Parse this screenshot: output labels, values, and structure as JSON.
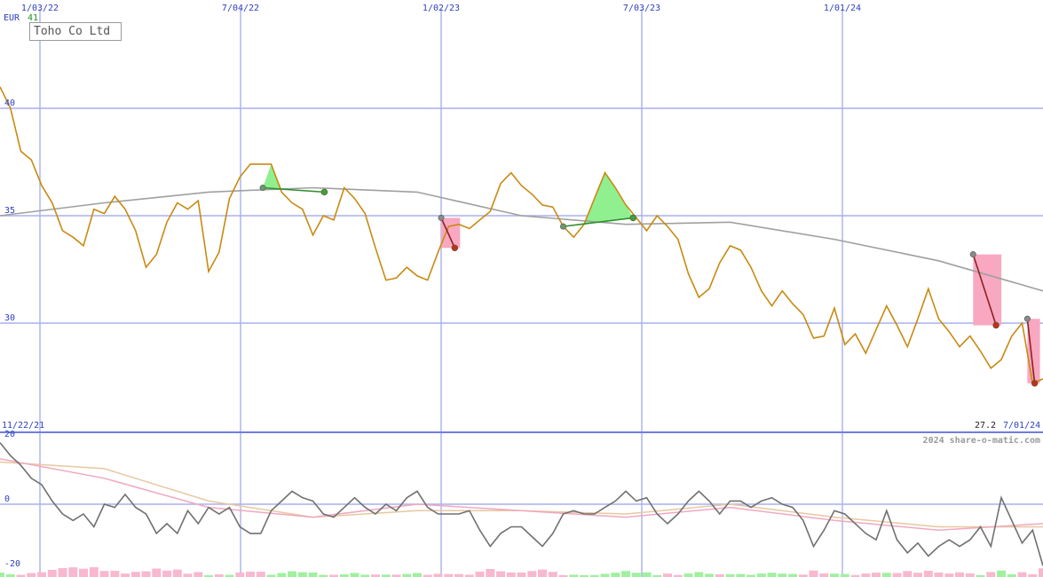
{
  "chart_data": [
    {
      "type": "line",
      "title": "Toho Co Ltd",
      "currency": "EUR",
      "currency_value": "41",
      "x_tick_labels": [
        "1/03/22",
        "7/04/22",
        "1/02/23",
        "7/03/23",
        "1/01/24"
      ],
      "start_date_label": "11/22/21",
      "end_date_label": "7/01/24",
      "last_value_label": "27.2",
      "credit": "2024 share-o-matic.com",
      "y_ticks": [
        40,
        35,
        30
      ],
      "ylim": [
        25,
        44
      ],
      "grid": true,
      "colors": {
        "price": "#c88a12",
        "moving_average": "#a0a0a0",
        "up_fill": "#90f090",
        "down_fill": "#f8a8c0"
      },
      "series": [
        {
          "role": "price",
          "x": [
            0,
            0.01,
            0.02,
            0.03,
            0.04,
            0.05,
            0.06,
            0.07,
            0.08,
            0.09,
            0.1,
            0.11,
            0.12,
            0.13,
            0.14,
            0.15,
            0.16,
            0.17,
            0.18,
            0.19,
            0.2,
            0.21,
            0.22,
            0.23,
            0.24,
            0.25,
            0.26,
            0.27,
            0.28,
            0.29,
            0.3,
            0.31,
            0.32,
            0.33,
            0.34,
            0.35,
            0.36,
            0.37,
            0.38,
            0.39,
            0.4,
            0.41,
            0.42,
            0.43,
            0.44,
            0.45,
            0.46,
            0.47,
            0.48,
            0.49,
            0.5,
            0.51,
            0.52,
            0.53,
            0.54,
            0.55,
            0.56,
            0.57,
            0.58,
            0.59,
            0.6,
            0.61,
            0.62,
            0.63,
            0.64,
            0.65,
            0.66,
            0.67,
            0.68,
            0.69,
            0.7,
            0.71,
            0.72,
            0.73,
            0.74,
            0.75,
            0.76,
            0.77,
            0.78,
            0.79,
            0.8,
            0.81,
            0.82,
            0.83,
            0.84,
            0.85,
            0.86,
            0.87,
            0.88,
            0.89,
            0.9,
            0.91,
            0.92,
            0.93,
            0.94,
            0.95,
            0.96,
            0.97,
            0.98,
            0.99,
            1
          ],
          "values": [
            41.0,
            40.0,
            38.0,
            37.6,
            36.4,
            35.6,
            34.3,
            34.0,
            33.6,
            35.3,
            35.1,
            35.9,
            35.3,
            34.3,
            32.6,
            33.2,
            34.7,
            35.6,
            35.3,
            35.7,
            32.4,
            33.3,
            35.8,
            36.8,
            37.4,
            37.4,
            37.4,
            36.1,
            35.6,
            35.3,
            34.1,
            35.0,
            34.8,
            36.3,
            35.8,
            35.1,
            33.5,
            32.0,
            32.1,
            32.6,
            32.2,
            32.0,
            33.3,
            34.5,
            34.6,
            34.4,
            34.8,
            35.2,
            36.5,
            37.0,
            36.4,
            36.0,
            35.5,
            35.4,
            34.5,
            34.0,
            34.6,
            35.8,
            37.0,
            36.3,
            35.5,
            34.9,
            34.3,
            35.0,
            34.5,
            33.9,
            32.3,
            31.2,
            31.6,
            32.8,
            33.6,
            33.4,
            32.6,
            31.5,
            30.8,
            31.5,
            30.9,
            30.4,
            29.3,
            29.4,
            30.7,
            29.0,
            29.5,
            28.6,
            29.7,
            30.8,
            29.9,
            28.9,
            30.2,
            31.6,
            30.2,
            29.6,
            28.9,
            29.4,
            28.7,
            27.9,
            28.3,
            29.4,
            30.0,
            27.2,
            27.4
          ],
          "note": "closing prices (EUR), x normalized over 11/22/21 .. 7/01/24"
        },
        {
          "role": "moving_average",
          "x": [
            0,
            0.1,
            0.2,
            0.3,
            0.4,
            0.5,
            0.6,
            0.7,
            0.8,
            0.9,
            1
          ],
          "values": [
            35.0,
            35.6,
            36.1,
            36.3,
            36.1,
            35.0,
            34.6,
            34.7,
            33.9,
            32.9,
            31.5
          ]
        }
      ],
      "annotations": [
        {
          "kind": "up",
          "start": [
            0.252,
            36.3
          ],
          "end": [
            0.311,
            36.1
          ]
        },
        {
          "kind": "down",
          "start": [
            0.423,
            34.9
          ],
          "end": [
            0.436,
            33.5
          ]
        },
        {
          "kind": "up",
          "start": [
            0.54,
            34.5
          ],
          "end": [
            0.607,
            34.9
          ]
        },
        {
          "kind": "down",
          "start": [
            0.933,
            33.2
          ],
          "end": [
            0.955,
            29.9
          ]
        },
        {
          "kind": "down",
          "start": [
            0.985,
            30.2
          ],
          "end": [
            0.992,
            27.2
          ]
        }
      ]
    },
    {
      "type": "line",
      "y_ticks": [
        20,
        0,
        -20
      ],
      "ylim": [
        -22,
        22
      ],
      "colors": {
        "momentum": "#707070",
        "signal_1": "#f0a8c0",
        "signal_2": "#e8c8a0",
        "bar_up": "#a0f0a0",
        "bar_down": "#f8b8d0"
      },
      "series": [
        {
          "role": "momentum",
          "x": [
            0,
            0.01,
            0.02,
            0.03,
            0.04,
            0.05,
            0.06,
            0.07,
            0.08,
            0.09,
            0.1,
            0.11,
            0.12,
            0.13,
            0.14,
            0.15,
            0.16,
            0.17,
            0.18,
            0.19,
            0.2,
            0.21,
            0.22,
            0.23,
            0.24,
            0.25,
            0.26,
            0.27,
            0.28,
            0.29,
            0.3,
            0.31,
            0.32,
            0.33,
            0.34,
            0.35,
            0.36,
            0.37,
            0.38,
            0.39,
            0.4,
            0.41,
            0.42,
            0.43,
            0.44,
            0.45,
            0.46,
            0.47,
            0.48,
            0.49,
            0.5,
            0.51,
            0.52,
            0.53,
            0.54,
            0.55,
            0.56,
            0.57,
            0.58,
            0.59,
            0.6,
            0.61,
            0.62,
            0.63,
            0.64,
            0.65,
            0.66,
            0.67,
            0.68,
            0.69,
            0.7,
            0.71,
            0.72,
            0.73,
            0.74,
            0.75,
            0.76,
            0.77,
            0.78,
            0.79,
            0.8,
            0.81,
            0.82,
            0.83,
            0.84,
            0.85,
            0.86,
            0.87,
            0.88,
            0.89,
            0.9,
            0.91,
            0.92,
            0.93,
            0.94,
            0.95,
            0.96,
            0.97,
            0.98,
            0.99,
            1
          ],
          "values": [
            19,
            15,
            12,
            8,
            6,
            1,
            -3,
            -5,
            -3,
            -7,
            0,
            -1,
            3,
            -1,
            -3,
            -9,
            -6,
            -9,
            -2,
            -6,
            -1,
            -3,
            -1,
            -7,
            -9,
            -9,
            -2,
            1,
            4,
            2,
            1,
            -3,
            -4,
            -1,
            2,
            -1,
            -3,
            0,
            -2,
            2,
            4,
            -1,
            -3,
            -3,
            -3,
            -2,
            -8,
            -13,
            -9,
            -7,
            -7,
            -10,
            -13,
            -9,
            -3,
            -2,
            -3,
            -3,
            -1,
            1,
            4,
            1,
            2,
            -3,
            -6,
            -3,
            1,
            4,
            1,
            -3,
            1,
            1,
            -1,
            1,
            2,
            0,
            -1,
            -5,
            -13,
            -8,
            -2,
            -3,
            -6,
            -9,
            -11,
            -2,
            -11,
            -15,
            -12,
            -16,
            -13,
            -11,
            -13,
            -11,
            -7,
            -13,
            2,
            -5,
            -12,
            -8,
            -19
          ],
          "note": "oscillator values, same x normalization as price"
        },
        {
          "role": "signal_1",
          "x": [
            0,
            0.1,
            0.2,
            0.3,
            0.4,
            0.5,
            0.6,
            0.7,
            0.8,
            0.9,
            1
          ],
          "values": [
            14,
            8,
            -1,
            -4,
            0,
            -2,
            -4,
            -1,
            -5,
            -8,
            -6
          ]
        },
        {
          "role": "signal_2",
          "x": [
            0,
            0.1,
            0.2,
            0.3,
            0.4,
            0.5,
            0.6,
            0.7,
            0.8,
            0.9,
            1
          ],
          "values": [
            13,
            11,
            1,
            -4,
            -2,
            -2,
            -3,
            0,
            -4,
            -7,
            -7
          ]
        }
      ]
    }
  ]
}
